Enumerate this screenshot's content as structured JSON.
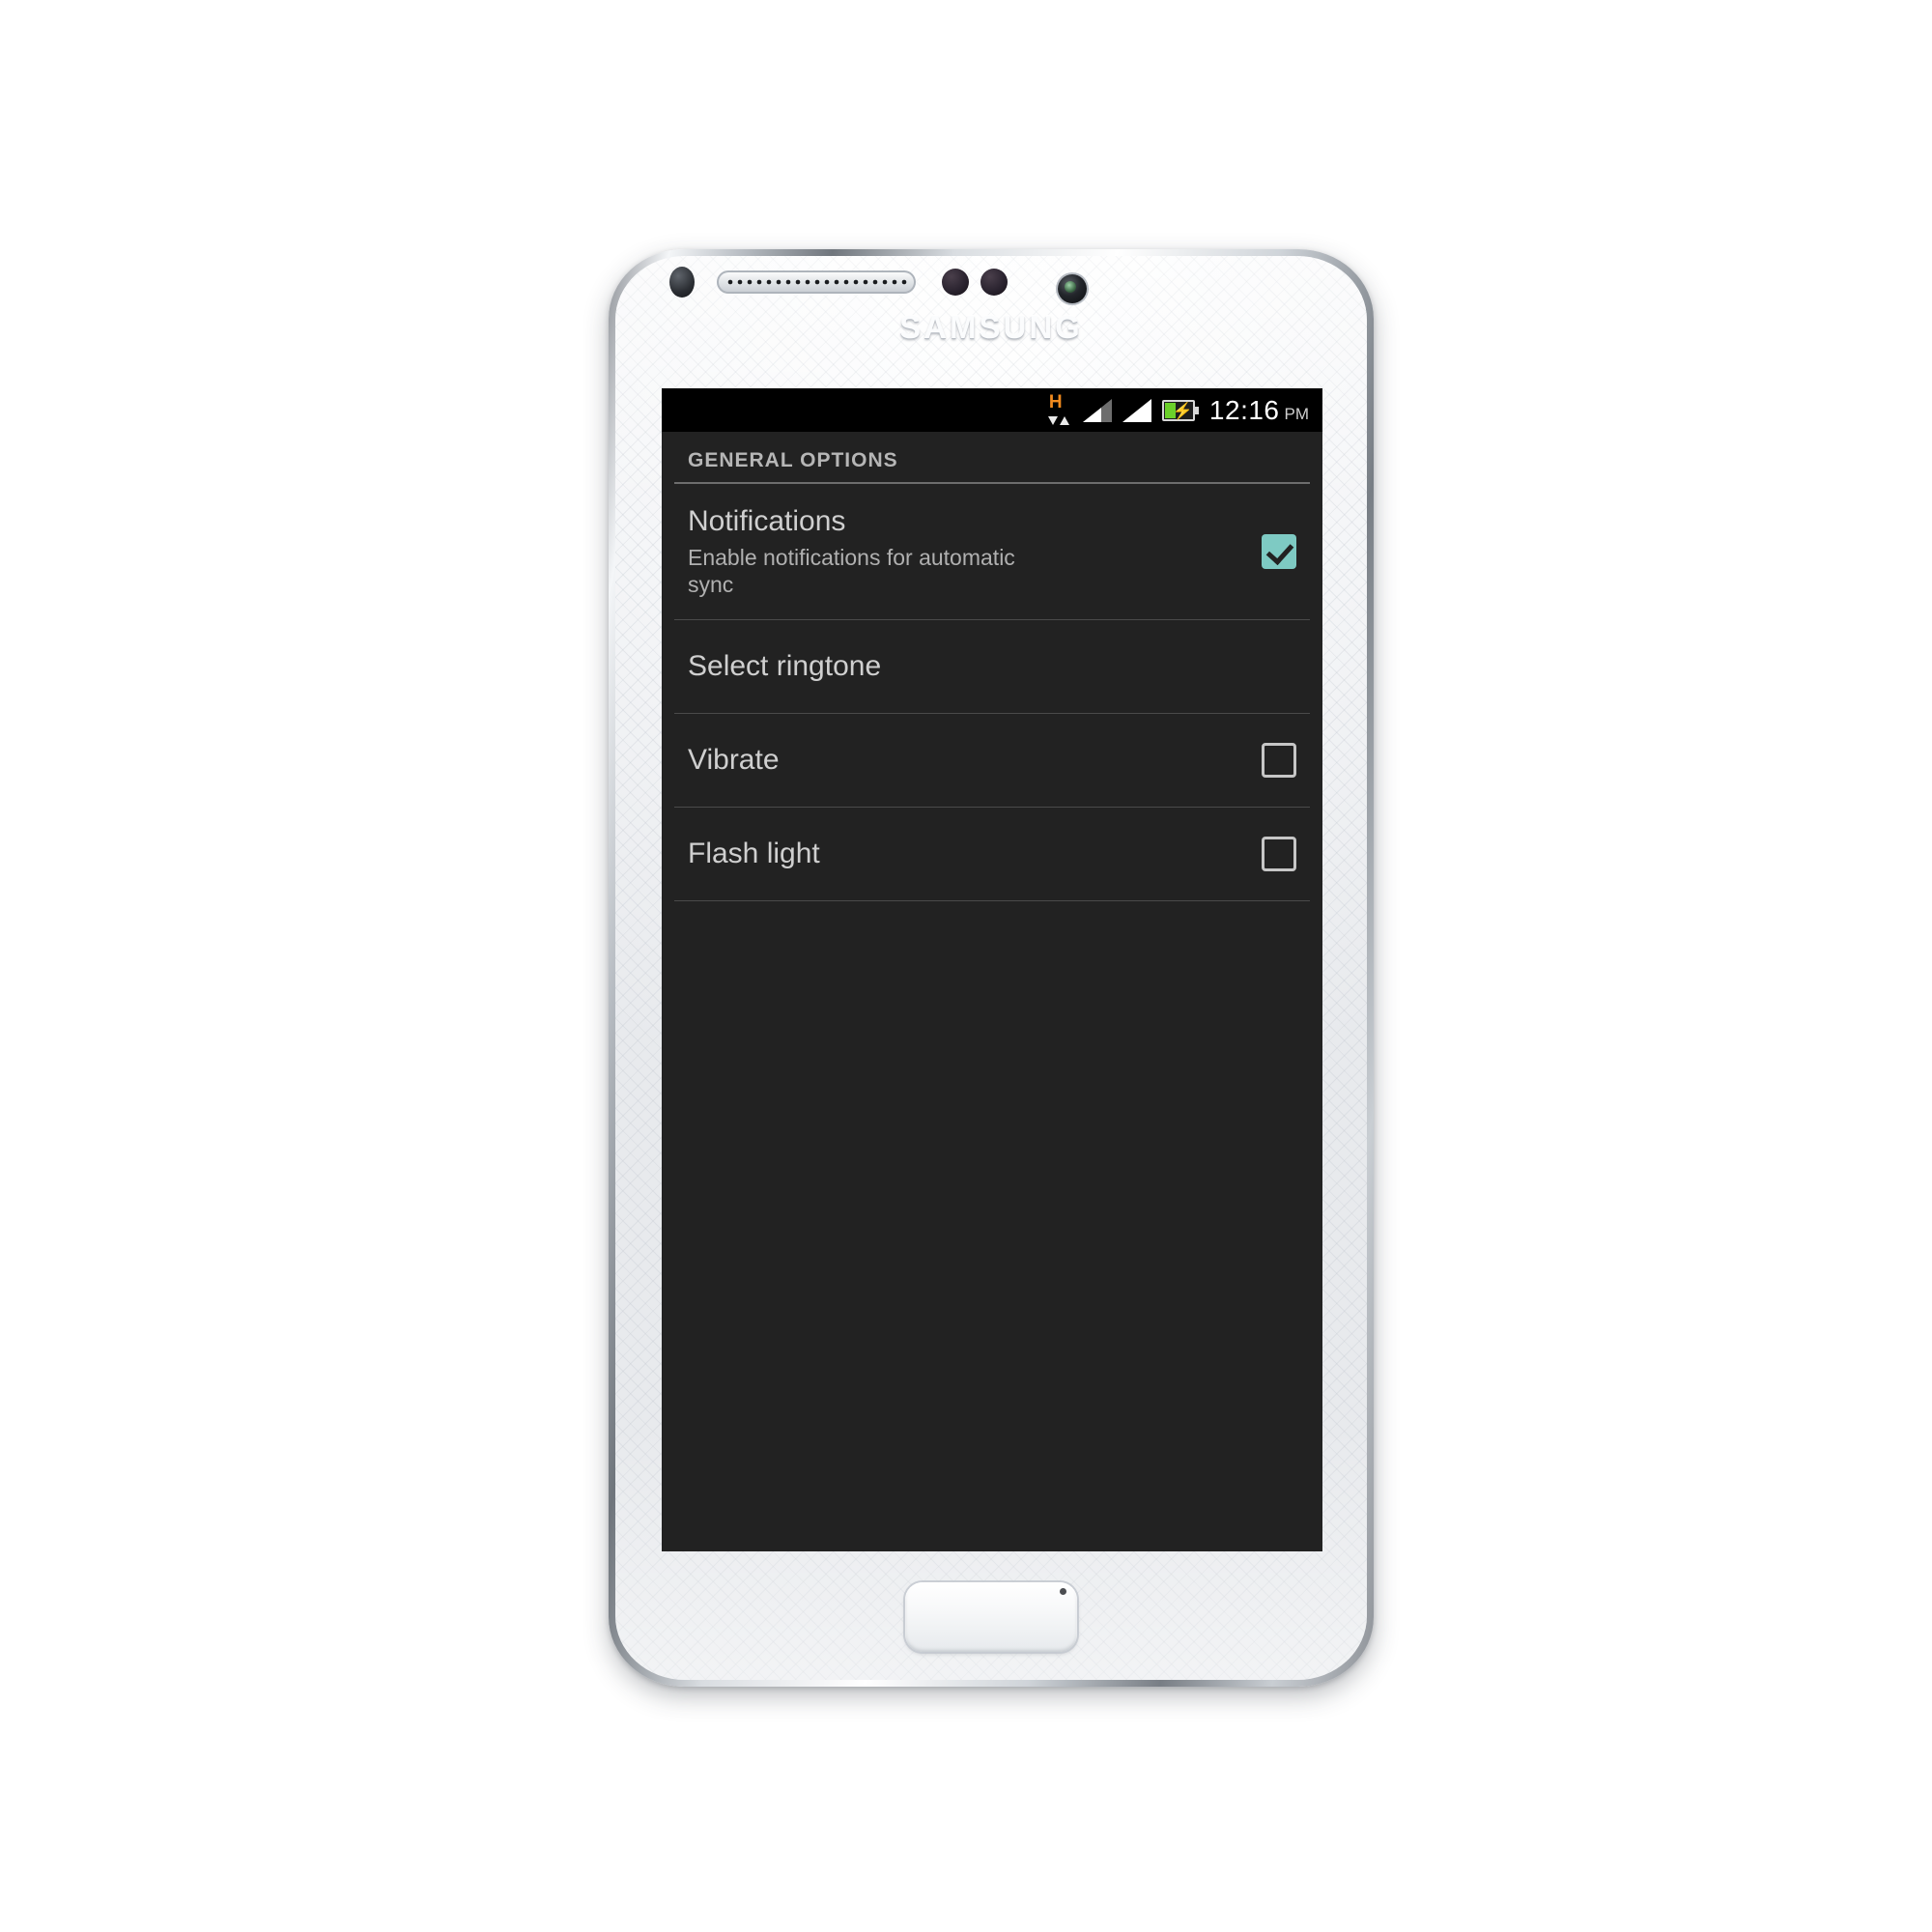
{
  "device": {
    "brand_label": "SAMSUNG",
    "hardware": {
      "earpiece": "earpiece-speaker",
      "proximity_sensor": "proximity-sensor",
      "light_sensor": "light-sensor",
      "front_camera": "front-camera",
      "home_button": "home-button"
    }
  },
  "statusbar": {
    "network_type": "H",
    "data_activity": "up-down-arrows",
    "signal_1": "signal-partial",
    "signal_2": "signal-full",
    "battery": "battery-charging",
    "time": "12:16",
    "ampm": "PM",
    "background": "#000000"
  },
  "screen": {
    "background": "#222222",
    "accent": "#7ecac3"
  },
  "settings": {
    "section_header": "GENERAL OPTIONS",
    "rows": [
      {
        "title": "Notifications",
        "summary": "Enable notifications for automatic sync",
        "control": "checkbox",
        "checked": true
      },
      {
        "title": "Select ringtone",
        "summary": "",
        "control": "none",
        "checked": false
      },
      {
        "title": "Vibrate",
        "summary": "",
        "control": "checkbox",
        "checked": false
      },
      {
        "title": "Flash light",
        "summary": "",
        "control": "checkbox",
        "checked": false
      }
    ]
  }
}
